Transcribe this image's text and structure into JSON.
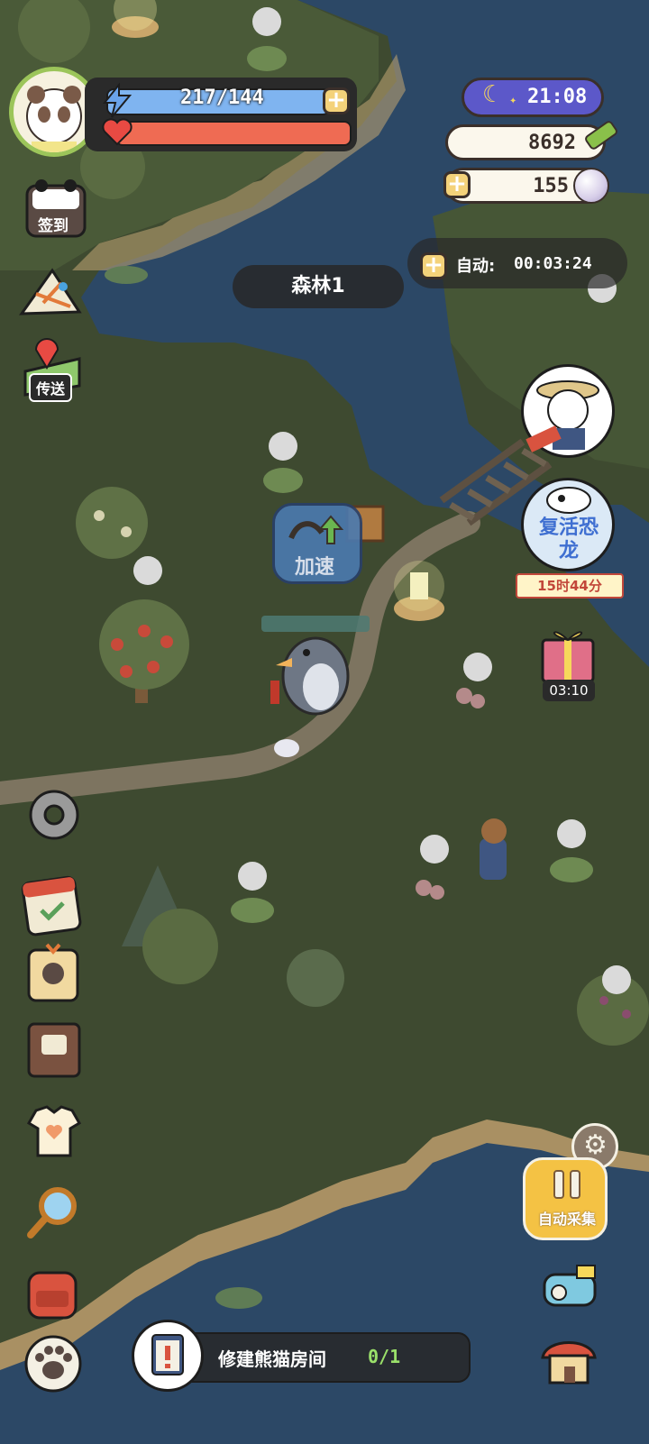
{
  "player": {
    "energy": "217/144",
    "health_fill": 1.0,
    "energy_fill": 1.0
  },
  "time": "21:08",
  "currency": {
    "bamboo": "8692",
    "pearls": "155"
  },
  "auto": {
    "label": "自动:",
    "timer": "00:03:24"
  },
  "area_name": "森林1",
  "left_menu": {
    "checkin": "签到",
    "teleport": "传送"
  },
  "boost": {
    "label": "加速"
  },
  "right_menu": {
    "revive_dino": "复活恐龙",
    "revive_timer": "15时44分",
    "gift_timer": "03:10",
    "auto_collect": "自动采集"
  },
  "quest": {
    "title": "修建熊猫房间",
    "progress": "0/1"
  },
  "colors": {
    "grass": "#3e4a30",
    "water": "#2c4866",
    "energy": "#7fb4f0",
    "health": "#ef6b53",
    "time_bg": "#5c58c9"
  }
}
